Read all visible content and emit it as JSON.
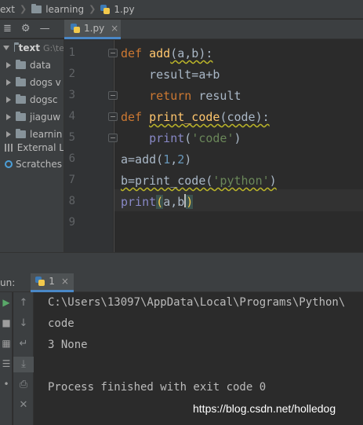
{
  "breadcrumb": {
    "project": "ext",
    "folder": "learning",
    "file": "1.py"
  },
  "project_panel": {
    "root_name": "text",
    "root_path": "G:\\te",
    "items": [
      {
        "label": "data"
      },
      {
        "label": "dogs v"
      },
      {
        "label": "dogsc"
      },
      {
        "label": "jiaguw"
      },
      {
        "label": "learnin"
      }
    ],
    "external": "External L",
    "scratches": "Scratches"
  },
  "editor": {
    "tab_label": "1.py",
    "tab_close": "×",
    "line_numbers": [
      "1",
      "2",
      "3",
      "4",
      "5",
      "6",
      "7",
      "8",
      "9"
    ],
    "lines": [
      {
        "parts": [
          [
            "kw",
            "def "
          ],
          [
            "fn",
            "add"
          ],
          [
            "tx",
            "(a,b):"
          ]
        ]
      },
      {
        "parts": [
          [
            "tx",
            "    result=a+b"
          ]
        ]
      },
      {
        "parts": [
          [
            "kw",
            "    return "
          ],
          [
            "tx",
            "result"
          ]
        ]
      },
      {
        "parts": [
          [
            "kw",
            "def "
          ],
          [
            "fn",
            "print_code"
          ],
          [
            "tx",
            "(code):"
          ]
        ]
      },
      {
        "parts": [
          [
            "bi",
            "    print"
          ],
          [
            "tx",
            "("
          ],
          [
            "st",
            "'code'"
          ],
          [
            "tx",
            ")"
          ]
        ]
      },
      {
        "parts": [
          [
            "tx",
            "a=add("
          ],
          [
            "nm",
            "1"
          ],
          [
            "tx",
            ","
          ],
          [
            "nm",
            "2"
          ],
          [
            "tx",
            ")"
          ]
        ]
      },
      {
        "parts": [
          [
            "tx",
            "b=print_code("
          ],
          [
            "st",
            "'python'"
          ],
          [
            "tx",
            ")"
          ]
        ]
      },
      {
        "parts": [
          [
            "bi",
            "print"
          ],
          [
            "brm",
            "("
          ],
          [
            "tx",
            "a,b"
          ],
          [
            "brm",
            ")"
          ]
        ]
      },
      {
        "parts": []
      }
    ]
  },
  "run": {
    "label": "un:",
    "tab_label": "1",
    "tab_close": "×",
    "output": [
      "C:\\Users\\13097\\AppData\\Local\\Programs\\Python\\",
      "code",
      "3 None",
      "",
      "Process finished with exit code 0"
    ]
  },
  "watermark": "https://blog.csdn.net/holledog"
}
